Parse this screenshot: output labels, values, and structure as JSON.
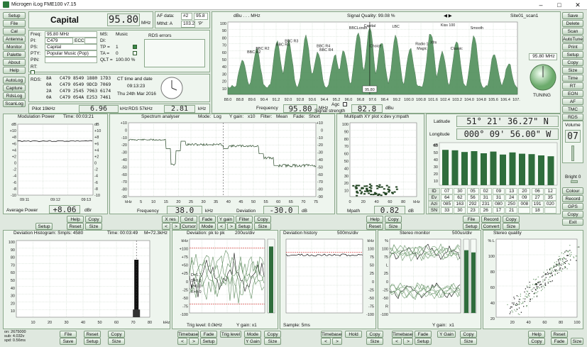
{
  "window": {
    "title": "Microgen iLog FME100 v7.15"
  },
  "left_buttons": [
    "Setup",
    "File",
    "Cal",
    "Antenna",
    "Monitor",
    "Palette",
    "About",
    "Help"
  ],
  "left_buttons2": [
    "AutoLog",
    "Capture",
    "RdsLog",
    "ScanLog"
  ],
  "right_buttons": [
    "Save",
    "Delete",
    "Scan",
    "AutoTune",
    "Print",
    "Setup",
    "Copy",
    "Size"
  ],
  "right_buttons2": [
    "Time",
    "RT",
    "EON",
    "AF",
    "TMC",
    "RDS"
  ],
  "right_buttons3": [
    "Colour",
    "Record",
    "GPS",
    "Copy",
    "Exit"
  ],
  "volume": {
    "label": "Volume",
    "value": "07",
    "bright_label": "Bright 0"
  },
  "station": {
    "name": "Capital",
    "freq": "95.80",
    "freq_unit": "MHz",
    "af_label": "AF data:",
    "af_num": "#2",
    "af_val": "95.8",
    "mthd_label": "Mthd: A",
    "mthd_num": "103.2",
    "mthd_unit": "'P'",
    "rds_errors": "RDS errors"
  },
  "info": {
    "freq_label": "Freq:",
    "freq_val": "95.80 MHz",
    "pi_label": "PI:",
    "pi_val": "C479",
    "ecc_label": "ECC:",
    "ps_label": "PS:",
    "ps_val": "Capital",
    "pty_label": "PTY:",
    "pty_val": "Popular Music (Pop)",
    "pin_label": "PIN:",
    "rt_label": "RT:",
    "ms_label": "MS:",
    "ms_val": "Music",
    "di_label": "DI:",
    "tp_label": "TP =",
    "tp_val": "1",
    "ta_label": "TA =",
    "ta_val": "0",
    "qlt_label": "QLT =",
    "qlt_val": "100.00 %"
  },
  "rds_groups": {
    "label": "RDS:",
    "rows": [
      [
        "8A",
        "C479",
        "8549",
        "1880",
        "17D3"
      ],
      [
        "0A",
        "C479",
        "0549",
        "9DCD",
        "7069"
      ],
      [
        "2A",
        "C479",
        "2545",
        "7963",
        "6174"
      ],
      [
        "0A",
        "C479",
        "054A",
        "E253",
        "7461"
      ]
    ]
  },
  "ct": {
    "label": "CT time and date",
    "time": "09:13:23",
    "date": "Thu 24th Mar 2016"
  },
  "pilot": {
    "label": "Pilot 19kHz",
    "value": "6.96",
    "unit": "kHz"
  },
  "rds57": {
    "label": "RDS 57kHz",
    "value": "2.81",
    "unit": "kHz"
  },
  "spectrum": {
    "db_label": "dBu . . . MHz",
    "quality": "Signal Quality: 99.08 %",
    "site": "Site01_scan1",
    "station_labels": [
      "BBC R2",
      "BBC R2",
      "BBC R3",
      "BBC R3",
      "BBC R4",
      "BBC R4",
      "BBCLondn",
      "Capital",
      "Kiss 100",
      "LBC",
      "Smooth",
      "Radio 1",
      "Magic",
      "Classic",
      "Xfm",
      "Choice"
    ],
    "marker": "95.80",
    "yaxis": [
      "100",
      "90",
      "80",
      "70",
      "60",
      "50",
      "40",
      "30",
      "20",
      "10"
    ],
    "xaxis": [
      "88.0",
      "88.8",
      "89.6",
      "90.4",
      "91.2",
      "92.0",
      "92.8",
      "93.6",
      "94.4",
      "95.2",
      "96.0",
      "96.8",
      "97.6",
      "98.4",
      "99.2",
      "100.0",
      "100.8",
      "101.6",
      "102.4",
      "103.2",
      "104.0",
      "104.8",
      "105.6",
      "106.4",
      "107.2"
    ],
    "freq_label": "Frequency",
    "freq_val": "95.80",
    "freq_unit": "MHz",
    "agc_label": "Agc",
    "strength_label": "Signal strength",
    "strength_val": "82.8",
    "strength_unit": "dBu",
    "tuning_label": "TUNING",
    "tuning_freq": "95.80 MHz"
  },
  "modulation": {
    "title": "Modulation Power",
    "time": "Time: 00:03:21",
    "yleft": [
      "dB",
      "+10",
      "+8",
      "+6",
      "+4",
      "+2",
      "0",
      "-2",
      "-4",
      "-6",
      "-8",
      "-10"
    ],
    "yright": [
      "dB",
      "+10",
      "+8",
      "+6",
      "+4",
      "+2",
      "0",
      "-2",
      "-4",
      "-6",
      "-8",
      "-10"
    ],
    "xaxis": [
      "09:11",
      "09:12",
      "09:13"
    ],
    "avg_label": "Average Power",
    "avg_val": "+8.06",
    "avg_unit": "dBr"
  },
  "spectrum_analyser": {
    "title": "Spectrum analyser",
    "mode": "Mode:",
    "mode_val": "Log",
    "ygain": "Y gain:",
    "ygain_val": "x10",
    "filter": "Filter:",
    "filter_val": "Mean",
    "fade": "Fade:",
    "fade_val": "Short",
    "yaxis": [
      "+10",
      "0",
      "-10",
      "-20",
      "-30",
      "-40",
      "-50",
      "-60",
      "-70",
      "-80",
      "-90"
    ],
    "xaxis": [
      "kHz",
      "5",
      "10",
      "15",
      "20",
      "25",
      "30",
      "35",
      "40",
      "45",
      "50",
      "55",
      "60",
      "65",
      "70",
      "75"
    ],
    "freq_label": "Frequency",
    "freq_val": "38.0",
    "freq_unit": "kHz",
    "dev_label": "Deviation",
    "dev_val": "-30.0",
    "dev_unit": "dB"
  },
  "multipath": {
    "title": "Multipath XY plot  x:dev y:mpath",
    "yaxis": [
      "100",
      "90",
      "80",
      "70",
      "60",
      "50",
      "40",
      "30",
      "20",
      "10"
    ],
    "xaxis": [
      "0",
      "20",
      "40",
      "60",
      "80",
      "kHz"
    ],
    "mpath_label": "Mpath",
    "mpath_val": "0.82",
    "mpath_unit": "dB"
  },
  "gps": {
    "lat_label": "Latitude",
    "lat_val": "51° 21' 36.27\" N",
    "lon_label": "Longitude",
    "lon_val": "000° 09' 56.00\" W",
    "db_label": "dB",
    "bars_y": [
      "60",
      "50",
      "40",
      "30",
      "20",
      "10"
    ],
    "table": {
      "id": [
        "ID",
        "07",
        "30",
        "05",
        "02",
        "09",
        "13",
        "20",
        "06",
        "12"
      ],
      "ev": [
        "Ev",
        "64",
        "62",
        "56",
        "31",
        "31",
        "24",
        "09",
        "27",
        "35"
      ],
      "az": [
        "Azi",
        "085",
        "163",
        "292",
        "231",
        "080",
        "250",
        "008",
        "191",
        "020"
      ],
      "sn": [
        "SN",
        "33",
        "30",
        "23",
        "26",
        "17",
        "21",
        "",
        "18",
        ""
      ]
    }
  },
  "row_buttons": {
    "set1": [
      "Help",
      "Copy",
      "Setup",
      "Reset",
      "Size"
    ],
    "set2": [
      "X res",
      "Grid",
      "Fade",
      "Y gain",
      "Filter",
      "Copy",
      "<",
      ">",
      "Cursor",
      "Mode",
      "<",
      ">",
      "Setup",
      "Size"
    ],
    "set3": [
      "Help",
      "Copy",
      "Reset",
      "Size"
    ],
    "set4": [
      "File",
      "Record",
      "Copy",
      "Setup",
      "Convert",
      "Size"
    ]
  },
  "dev_hist": {
    "title": "Deviation Histogram: Smpls: 4580",
    "time": "Time: 00:03:49",
    "max": "M=72.3kHz",
    "yaxis": [
      "100",
      "90",
      "80",
      "70",
      "60",
      "50",
      "40",
      "30",
      "20",
      "10"
    ],
    "xaxis": [
      "10",
      "20",
      "30",
      "40",
      "50",
      "60",
      "70",
      "80",
      "kHz"
    ]
  },
  "deviation": {
    "title": "Deviation: pk to pk",
    "rate": "200us/div",
    "yaxis": [
      "kHz",
      "+100",
      "+75",
      "+50",
      "+25",
      "0",
      "-25",
      "-50",
      "-75",
      "-100"
    ],
    "stats": [
      "D=1.7",
      "S=0.0",
      "P=0.0",
      "K=0.0"
    ],
    "trig_label": "Trig level: 0.0kHz",
    "ygain": "Y gain: x1"
  },
  "dev_history": {
    "title": "Deviation history",
    "rate": "500ms/div",
    "yaxis_l": [
      "kHz",
      "100",
      "75",
      "50",
      "25",
      "0",
      "-25",
      "-50",
      "-75",
      "-100"
    ],
    "yaxis_r": [
      "kHz",
      "100",
      "75",
      "50",
      "25",
      "0",
      "-25",
      "-50",
      "-75",
      "-100"
    ],
    "sample": "Sample: 5ms"
  },
  "stereo_monitor": {
    "title": "Stereo monitor",
    "rate": "500us/div",
    "yaxis": [
      "%",
      "100",
      "75",
      "L",
      "25",
      "0",
      "-25",
      "-50",
      "R",
      "-100"
    ],
    "ygain": "Y gain:",
    "ygain_val": "x1"
  },
  "stereo_quality": {
    "title": "Stereo quality",
    "yaxis": [
      "% L",
      "100",
      "80",
      "60",
      "40",
      "20"
    ],
    "xaxis": [
      "20",
      "40",
      "60",
      "80",
      "100",
      "R"
    ]
  },
  "bottom_stats": [
    "on: 2675000",
    "sub: 4.032v",
    "spd: 0.56ms"
  ],
  "bottom_buttons": {
    "hist": [
      "File",
      "Reset",
      "Copy",
      "Save",
      "Setup",
      "Size"
    ],
    "dev": [
      "Timebase",
      "Fade",
      "Trig level",
      "Mode",
      "Copy",
      "<",
      ">",
      "Setup",
      "Y Gain",
      "Size"
    ],
    "hist2": [
      "Timebase",
      "Hold",
      "Copy",
      "<",
      ">",
      "Size"
    ],
    "stereo": [
      "Timebase",
      "Fade",
      "Y Gain",
      "Copy",
      "<",
      ">",
      "Setup",
      "Size"
    ],
    "quality": [
      "Help",
      "Reset",
      "Copy",
      "Fade",
      "Size"
    ]
  }
}
